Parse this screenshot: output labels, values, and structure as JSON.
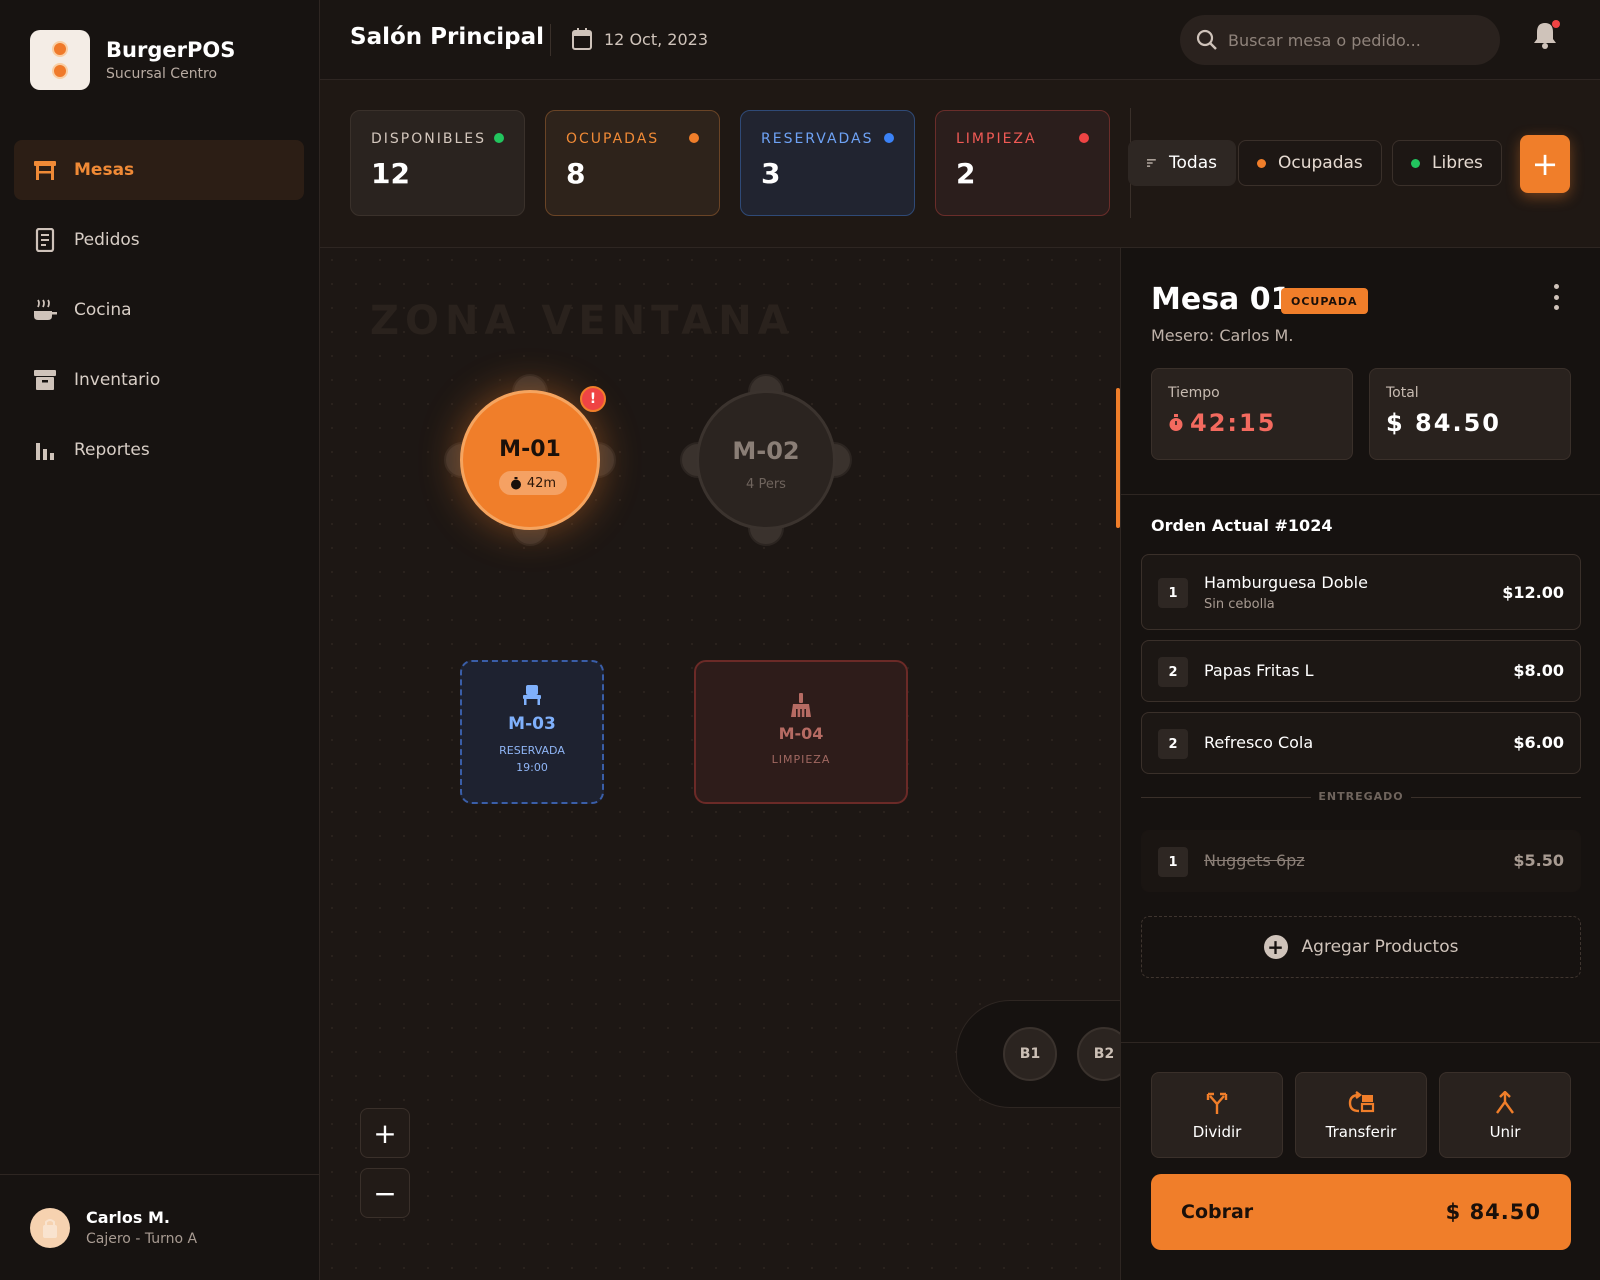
{
  "brand": {
    "name": "BurgerPOS",
    "subtitle": "Sucursal Centro"
  },
  "nav": [
    {
      "label": "Mesas",
      "icon": "table-icon",
      "active": true
    },
    {
      "label": "Pedidos",
      "icon": "receipt-icon",
      "active": false
    },
    {
      "label": "Cocina",
      "icon": "kitchen-icon",
      "active": false
    },
    {
      "label": "Inventario",
      "icon": "archive-icon",
      "active": false
    },
    {
      "label": "Reportes",
      "icon": "bar-chart-icon",
      "active": false
    }
  ],
  "user": {
    "name": "Carlos M.",
    "role": "Cajero - Turno A"
  },
  "header": {
    "title": "Salón Principal",
    "date": "12 Oct, 2023",
    "search_placeholder": "Buscar mesa o pedido..."
  },
  "stats": [
    {
      "label": "DISPONIBLES",
      "value": "12",
      "color": "#22c55e"
    },
    {
      "label": "OCUPADAS",
      "value": "8",
      "color": "#f07e2a"
    },
    {
      "label": "RESERVADAS",
      "value": "3",
      "color": "#3b82f6"
    },
    {
      "label": "LIMPIEZA",
      "value": "2",
      "color": "#ef4444"
    }
  ],
  "filters": [
    {
      "label": "Todas",
      "active": true
    },
    {
      "label": "Ocupadas",
      "color": "#f07e2a"
    },
    {
      "label": "Libres",
      "color": "#22c55e"
    }
  ],
  "floor": {
    "zone": "ZONA VENTANA",
    "tables": {
      "m01": {
        "name": "M-01",
        "time": "42m",
        "alert": "!"
      },
      "m02": {
        "name": "M-02",
        "sub": "4 Pers"
      },
      "m03": {
        "name": "M-03",
        "status": "RESERVADA",
        "time": "19:00"
      },
      "m04": {
        "name": "M-04",
        "status": "LIMPIEZA"
      }
    },
    "bar_seats": [
      "B1",
      "B2"
    ],
    "zoom_in": "+",
    "zoom_out": "−"
  },
  "panel": {
    "title": "Mesa 01",
    "badge": "OCUPADA",
    "waiter": "Mesero: Carlos M.",
    "time_label": "Tiempo",
    "time_value": "42:15",
    "total_label": "Total",
    "total_value": "$ 84.50",
    "order_title": "Orden Actual #1024",
    "items": [
      {
        "qty": "1",
        "name": "Hamburguesa Doble",
        "note": "Sin cebolla",
        "price": "$12.00"
      },
      {
        "qty": "2",
        "name": "Papas Fritas L",
        "price": "$8.00"
      },
      {
        "qty": "2",
        "name": "Refresco Cola",
        "price": "$6.00"
      }
    ],
    "delivered_label": "ENTREGADO",
    "delivered": [
      {
        "qty": "1",
        "name": "Nuggets 6pz",
        "price": "$5.50"
      }
    ],
    "add_products": "Agregar Productos",
    "actions": [
      {
        "label": "Dividir",
        "icon": "split-icon"
      },
      {
        "label": "Transferir",
        "icon": "transfer-icon"
      },
      {
        "label": "Unir",
        "icon": "merge-icon"
      }
    ],
    "pay_label": "Cobrar",
    "pay_amount": "$ 84.50"
  },
  "colors": {
    "accent": "#f07e2a",
    "background": "#1c1613",
    "panel": "#161210"
  }
}
